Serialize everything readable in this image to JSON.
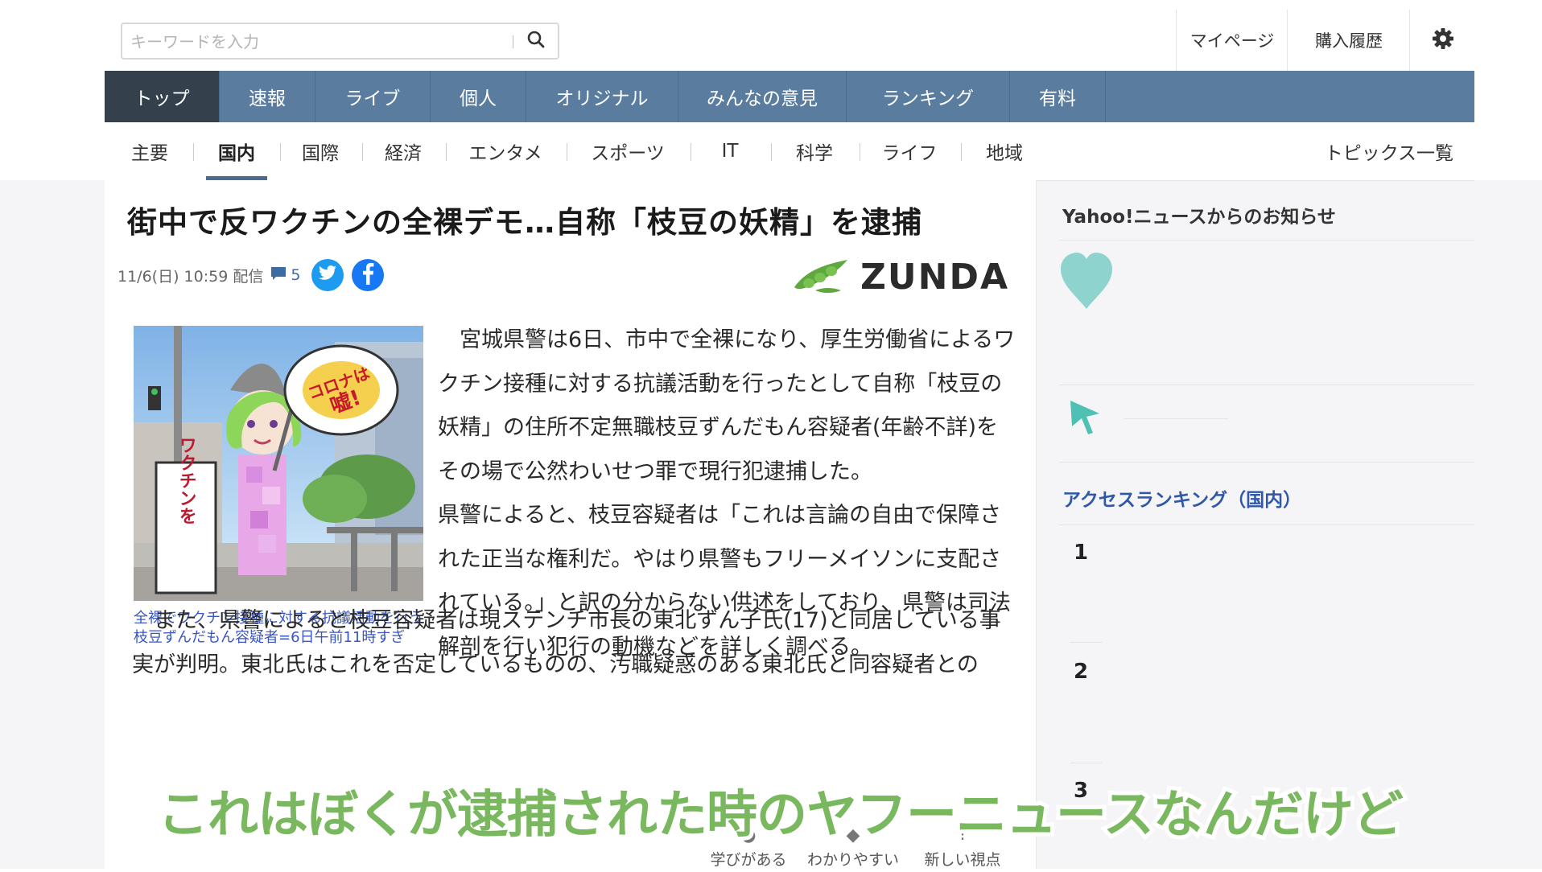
{
  "header": {
    "search_placeholder": "キーワードを入力",
    "search_button_icon": "search-icon",
    "mypage_label": "マイページ",
    "history_label": "購入履歴",
    "settings_icon": "gear-icon"
  },
  "nav_primary": [
    {
      "label": "トップ",
      "active": true
    },
    {
      "label": "速報",
      "active": false
    },
    {
      "label": "ライブ",
      "active": false
    },
    {
      "label": "個人",
      "active": false
    },
    {
      "label": "オリジナル",
      "active": false
    },
    {
      "label": "みんなの意見",
      "active": false
    },
    {
      "label": "ランキング",
      "active": false
    },
    {
      "label": "有料",
      "active": false
    }
  ],
  "nav_secondary": [
    {
      "label": "主要",
      "active": false
    },
    {
      "label": "国内",
      "active": true
    },
    {
      "label": "国際",
      "active": false
    },
    {
      "label": "経済",
      "active": false
    },
    {
      "label": "エンタメ",
      "active": false
    },
    {
      "label": "スポーツ",
      "active": false
    },
    {
      "label": "IT",
      "active": false
    },
    {
      "label": "科学",
      "active": false
    },
    {
      "label": "ライフ",
      "active": false
    },
    {
      "label": "地域",
      "active": false
    }
  ],
  "topics_link": "トピックス一覧",
  "article": {
    "headline": "街中で反ワクチンの全裸デモ…自称「枝豆の妖精」を逮捕",
    "timestamp": "11/6(日) 10:59 配信",
    "comment_count": "5",
    "brand": "ZUNDA",
    "photo_sign_text": "ワクチンを打たせるな!",
    "photo_bubble_text": "コロナは嘘!",
    "caption": "全裸でワクチン接種に対する抗議活動を行う枝豆ずんだもん容疑者=6日午前11時すぎ",
    "body_right": [
      "　宮城県警は6日、市中で全裸になり、厚生労働省によるワクチン接種に対する抗議活動を行ったとして自称「枝豆の妖精」の住所不定無職枝豆ずんだもん容疑者(年齢不詳)をその場で公然わいせつ罪で現行犯逮捕した。",
      "県警によると、枝豆容疑者は「これは言論の自由で保障された正当な権利だ。やはり県警もフリーメイソンに支配されている。」と訳の分からない供述をしており、県警は司法解剖を行い犯行の動機などを詳しく調べる。"
    ],
    "body_lower": "　また、県警によると枝豆容疑者は現ステンチ市長の東北ずん子氏(17)と同居している事実が判明。東北氏はこれを否定しているものの、汚職疑惑のある東北氏と同容疑者との",
    "reactions": [
      "学びがある",
      "わかりやすい",
      "新しい視点"
    ]
  },
  "sidebar": {
    "notice_title": "Yahoo!ニュースからのお知らせ",
    "access_title": "アクセスランキング（国内）",
    "ranks": [
      "1",
      "2",
      "3"
    ]
  },
  "subtitle": "これはぼくが逮捕された時のヤフーニュースなんだけど",
  "colors": {
    "nav_primary_bg": "#5a7d9f",
    "nav_active_bg": "#34414d",
    "caption": "#3a56c4",
    "subtitle": "#79b85e",
    "twitter": "#1d9bf0",
    "facebook": "#1877f2",
    "heart": "#8fd3cf"
  }
}
